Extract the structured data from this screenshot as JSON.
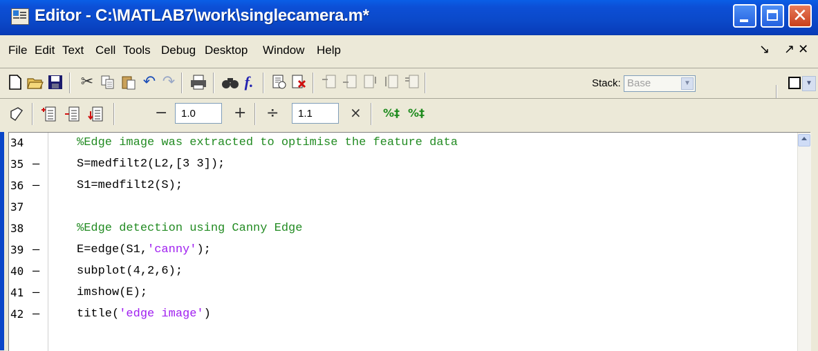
{
  "window": {
    "title": "Editor - C:\\MATLAB7\\work\\singlecamera.m*"
  },
  "menu": [
    "File",
    "Edit",
    "Text",
    "Cell",
    "Tools",
    "Debug",
    "Desktop",
    "Window",
    "Help"
  ],
  "menu_right": {
    "undock": "↘",
    "dock": "↗ ✕"
  },
  "toolbar": {
    "stack_label": "Stack:",
    "stack_value": "Base"
  },
  "cell_toolbar": {
    "decrement": "−",
    "value1": "1.0",
    "increment": "+",
    "divide": "÷",
    "value2": "1.1",
    "multiply": "×"
  },
  "code_lines": [
    {
      "num": "34",
      "dash": "",
      "code": "%Edge image was extracted to optimise the feature data",
      "type": "comment"
    },
    {
      "num": "35",
      "dash": "–",
      "code": "S=medfilt2(L2,[3 3]);",
      "type": "code"
    },
    {
      "num": "36",
      "dash": "–",
      "code": "S1=medfilt2(S);",
      "type": "code"
    },
    {
      "num": "37",
      "dash": "",
      "code": "",
      "type": "code"
    },
    {
      "num": "38",
      "dash": "",
      "code": "%Edge detection using Canny Edge",
      "type": "comment"
    },
    {
      "num": "39",
      "dash": "–",
      "code_pre": "E=edge(S1,",
      "code_str": "'canny'",
      "code_post": ");",
      "type": "mixed"
    },
    {
      "num": "40",
      "dash": "–",
      "code": "subplot(4,2,6);",
      "type": "code"
    },
    {
      "num": "41",
      "dash": "–",
      "code": "imshow(E);",
      "type": "code"
    },
    {
      "num": "42",
      "dash": "–",
      "code_pre": "title(",
      "code_str": "'edge image'",
      "code_post": ")",
      "type": "mixed"
    }
  ],
  "colors": {
    "titlebar": "#0b49c9",
    "comment": "#228b22",
    "string": "#a020f0",
    "chrome": "#ece9d8"
  }
}
